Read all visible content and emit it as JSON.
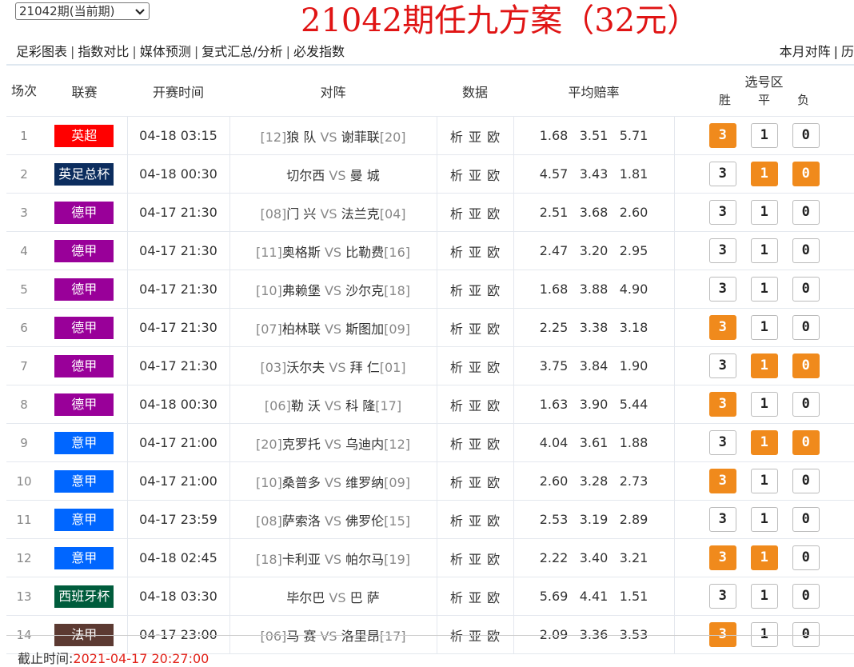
{
  "period_select": {
    "value": "21042期(当前期)"
  },
  "page_title": "21042期任九方案（32元）",
  "nav": {
    "links": [
      "足彩图表",
      "指数对比",
      "媒体预测",
      "复式汇总/分析",
      "必发指数"
    ],
    "right_links": [
      "本月对阵",
      "历"
    ]
  },
  "table": {
    "headers": {
      "index": "场次",
      "league": "联赛",
      "time": "开赛时间",
      "match": "对阵",
      "data": "数据",
      "odds": "平均赔率",
      "pick": "选号区",
      "pick_win": "胜",
      "pick_draw": "平",
      "pick_lose": "负"
    },
    "vs_text": "VS",
    "data_links": [
      "析",
      "亚",
      "欧"
    ],
    "rows": [
      {
        "idx": "1",
        "league": "英超",
        "league_color": "#ff0000",
        "time": "04-18 03:15",
        "home_rank": "[12]",
        "home": "狼 队",
        "away": "谢菲联",
        "away_rank": "[20]",
        "odds": [
          "1.68",
          "3.51",
          "5.71"
        ],
        "picks": [
          "3",
          "1",
          "0"
        ],
        "selected": [
          true,
          false,
          false
        ]
      },
      {
        "idx": "2",
        "league": "英足总杯",
        "league_color": "#0c2d5e",
        "time": "04-18 00:30",
        "home_rank": "",
        "home": "切尔西",
        "away": "曼 城",
        "away_rank": "",
        "odds": [
          "4.57",
          "3.43",
          "1.81"
        ],
        "picks": [
          "3",
          "1",
          "0"
        ],
        "selected": [
          false,
          true,
          true
        ]
      },
      {
        "idx": "3",
        "league": "德甲",
        "league_color": "#990099",
        "time": "04-17 21:30",
        "home_rank": "[08]",
        "home": "门 兴",
        "away": "法兰克",
        "away_rank": "[04]",
        "odds": [
          "2.51",
          "3.68",
          "2.60"
        ],
        "picks": [
          "3",
          "1",
          "0"
        ],
        "selected": [
          false,
          false,
          false
        ]
      },
      {
        "idx": "4",
        "league": "德甲",
        "league_color": "#990099",
        "time": "04-17 21:30",
        "home_rank": "[11]",
        "home": "奥格斯",
        "away": "比勒费",
        "away_rank": "[16]",
        "odds": [
          "2.47",
          "3.20",
          "2.95"
        ],
        "picks": [
          "3",
          "1",
          "0"
        ],
        "selected": [
          false,
          false,
          false
        ]
      },
      {
        "idx": "5",
        "league": "德甲",
        "league_color": "#990099",
        "time": "04-17 21:30",
        "home_rank": "[10]",
        "home": "弗赖堡",
        "away": "沙尔克",
        "away_rank": "[18]",
        "odds": [
          "1.68",
          "3.88",
          "4.90"
        ],
        "picks": [
          "3",
          "1",
          "0"
        ],
        "selected": [
          false,
          false,
          false
        ]
      },
      {
        "idx": "6",
        "league": "德甲",
        "league_color": "#990099",
        "time": "04-17 21:30",
        "home_rank": "[07]",
        "home": "柏林联",
        "away": "斯图加",
        "away_rank": "[09]",
        "odds": [
          "2.25",
          "3.38",
          "3.18"
        ],
        "picks": [
          "3",
          "1",
          "0"
        ],
        "selected": [
          true,
          false,
          false
        ]
      },
      {
        "idx": "7",
        "league": "德甲",
        "league_color": "#990099",
        "time": "04-17 21:30",
        "home_rank": "[03]",
        "home": "沃尔夫",
        "away": "拜 仁",
        "away_rank": "[01]",
        "odds": [
          "3.75",
          "3.84",
          "1.90"
        ],
        "picks": [
          "3",
          "1",
          "0"
        ],
        "selected": [
          false,
          true,
          true
        ]
      },
      {
        "idx": "8",
        "league": "德甲",
        "league_color": "#990099",
        "time": "04-18 00:30",
        "home_rank": "[06]",
        "home": "勒 沃",
        "away": "科 隆",
        "away_rank": "[17]",
        "odds": [
          "1.63",
          "3.90",
          "5.44"
        ],
        "picks": [
          "3",
          "1",
          "0"
        ],
        "selected": [
          true,
          false,
          false
        ]
      },
      {
        "idx": "9",
        "league": "意甲",
        "league_color": "#0066ff",
        "time": "04-17 21:00",
        "home_rank": "[20]",
        "home": "克罗托",
        "away": "乌迪内",
        "away_rank": "[12]",
        "odds": [
          "4.04",
          "3.61",
          "1.88"
        ],
        "picks": [
          "3",
          "1",
          "0"
        ],
        "selected": [
          false,
          true,
          true
        ]
      },
      {
        "idx": "10",
        "league": "意甲",
        "league_color": "#0066ff",
        "time": "04-17 21:00",
        "home_rank": "[10]",
        "home": "桑普多",
        "away": "维罗纳",
        "away_rank": "[09]",
        "odds": [
          "2.60",
          "3.28",
          "2.73"
        ],
        "picks": [
          "3",
          "1",
          "0"
        ],
        "selected": [
          true,
          false,
          false
        ]
      },
      {
        "idx": "11",
        "league": "意甲",
        "league_color": "#0066ff",
        "time": "04-17 23:59",
        "home_rank": "[08]",
        "home": "萨索洛",
        "away": "佛罗伦",
        "away_rank": "[15]",
        "odds": [
          "2.53",
          "3.19",
          "2.89"
        ],
        "picks": [
          "3",
          "1",
          "0"
        ],
        "selected": [
          false,
          false,
          false
        ]
      },
      {
        "idx": "12",
        "league": "意甲",
        "league_color": "#0066ff",
        "time": "04-18 02:45",
        "home_rank": "[18]",
        "home": "卡利亚",
        "away": "帕尔马",
        "away_rank": "[19]",
        "odds": [
          "2.22",
          "3.40",
          "3.21"
        ],
        "picks": [
          "3",
          "1",
          "0"
        ],
        "selected": [
          true,
          true,
          false
        ]
      },
      {
        "idx": "13",
        "league": "西班牙杯",
        "league_color": "#005c3c",
        "time": "04-18 03:30",
        "home_rank": "",
        "home": "毕尔巴",
        "away": "巴 萨",
        "away_rank": "",
        "odds": [
          "5.69",
          "4.41",
          "1.51"
        ],
        "picks": [
          "3",
          "1",
          "0"
        ],
        "selected": [
          false,
          false,
          false
        ]
      },
      {
        "idx": "14",
        "league": "法甲",
        "league_color": "#5c3a32",
        "time": "04-17 23:00",
        "home_rank": "[06]",
        "home": "马 赛",
        "away": "洛里昂",
        "away_rank": "[17]",
        "odds": [
          "2.09",
          "3.36",
          "3.53"
        ],
        "picks": [
          "3",
          "1",
          "0"
        ],
        "selected": [
          true,
          false,
          false
        ]
      }
    ]
  },
  "deadline": {
    "label": "截止时间:",
    "value": "2021-04-17 20:27:00"
  },
  "colors": {
    "accent": "#f08a1c",
    "title_red": "#e01414"
  }
}
